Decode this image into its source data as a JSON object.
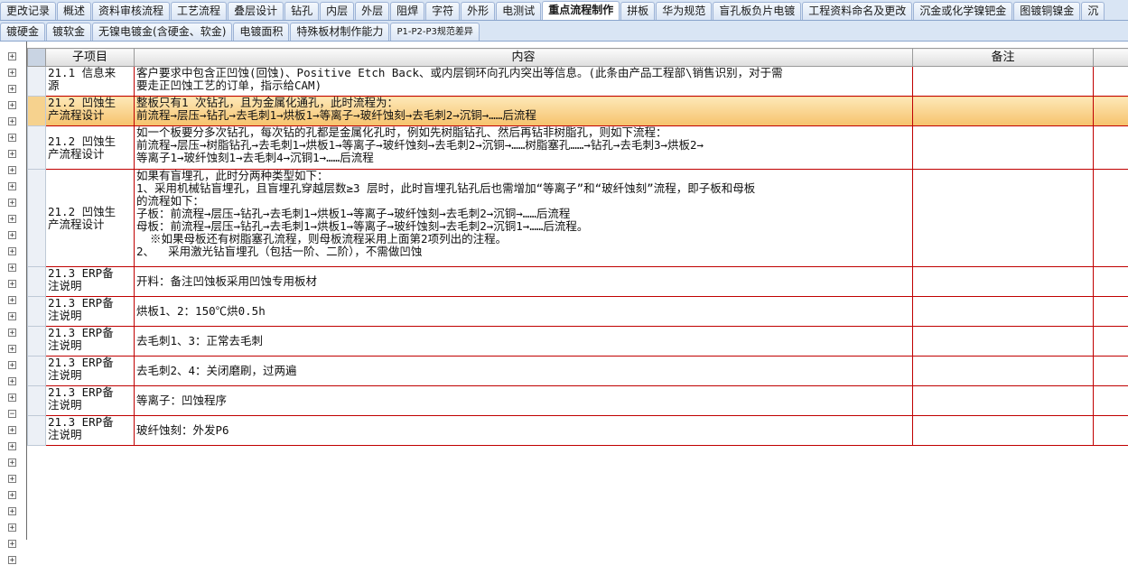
{
  "tabs_row1": [
    {
      "label": "更改记录",
      "active": false
    },
    {
      "label": "概述",
      "active": false
    },
    {
      "label": "资料审核流程",
      "active": false
    },
    {
      "label": "工艺流程",
      "active": false
    },
    {
      "label": "叠层设计",
      "active": false
    },
    {
      "label": "钻孔",
      "active": false
    },
    {
      "label": "内层",
      "active": false
    },
    {
      "label": "外层",
      "active": false
    },
    {
      "label": "阻焊",
      "active": false
    },
    {
      "label": "字符",
      "active": false
    },
    {
      "label": "外形",
      "active": false
    },
    {
      "label": "电测试",
      "active": false
    },
    {
      "label": "重点流程制作",
      "active": true
    },
    {
      "label": "拼板",
      "active": false
    },
    {
      "label": "华为规范",
      "active": false
    },
    {
      "label": "盲孔板负片电镀",
      "active": false
    },
    {
      "label": "工程资料命名及更改",
      "active": false
    },
    {
      "label": "沉金或化学镍钯金",
      "active": false
    },
    {
      "label": "图镀铜镍金",
      "active": false
    },
    {
      "label": "沉",
      "active": false
    }
  ],
  "tabs_row2": [
    {
      "label": "镀硬金",
      "active": false
    },
    {
      "label": "镀软金",
      "active": false
    },
    {
      "label": "无镍电镀金(含硬金、软金)",
      "active": false
    },
    {
      "label": "电镀面积",
      "active": false
    },
    {
      "label": "特殊板材制作能力",
      "active": false
    },
    {
      "label": "P1-P2-P3规范差异",
      "active": false
    }
  ],
  "grid": {
    "headers": {
      "sub": "子项目",
      "content": "内容",
      "remark": "备注"
    },
    "rows": [
      {
        "sub": [
          "21.1 信息来",
          "源"
        ],
        "content": [
          "客户要求中包含正凹蚀(回蚀)、Positive Etch Back、或内层铜环向孔内突出等信息。(此条由产品工程部\\销售识别，对于需",
          "要走正凹蚀工艺的订单，指示给CAM)"
        ],
        "remark": "",
        "selected": false
      },
      {
        "sub": [
          "21.2 凹蚀生",
          "产流程设计"
        ],
        "content": [
          "整板只有1 次钻孔，且为金属化通孔，此时流程为：",
          "前流程→层压→钻孔→去毛刺1→烘板1→等离子→玻纤蚀刻→去毛刺2→沉铜→……后流程"
        ],
        "remark": "",
        "selected": true
      },
      {
        "sub": [
          "21.2 凹蚀生",
          "产流程设计"
        ],
        "content": [
          "如一个板要分多次钻孔，每次钻的孔都是金属化孔时，例如先树脂钻孔、然后再钻非树脂孔，则如下流程：",
          "前流程→层压→树脂钻孔→去毛刺1→烘板1→等离子→玻纤蚀刻→去毛刺2→沉铜→……树脂塞孔……→钻孔→去毛刺3→烘板2→",
          "等离子1→玻纤蚀刻1→去毛刺4→沉铜1→……后流程"
        ],
        "remark": "",
        "selected": false
      },
      {
        "sub": [
          "21.2 凹蚀生",
          "产流程设计"
        ],
        "content": [
          "如果有盲埋孔，此时分两种类型如下：",
          "1、采用机械钻盲埋孔，且盲埋孔穿越层数≥3 层时，此时盲埋孔钻孔后也需增加“等离子”和“玻纤蚀刻”流程，即子板和母板",
          "的流程如下：",
          "子板：前流程→层压→钻孔→去毛刺1→烘板1→等离子→玻纤蚀刻→去毛刺2→沉铜→……后流程",
          "母板：前流程→层压→钻孔→去毛刺1→烘板1→等离子→玻纤蚀刻→去毛刺2→沉铜1→……后流程。",
          "  ※如果母板还有树脂塞孔流程，则母板流程采用上面第2项列出的注程。",
          "2、  采用激光钻盲埋孔（包括一阶、二阶），不需做凹蚀"
        ],
        "remark": "",
        "selected": false
      },
      {
        "sub": [
          "21.3 ERP备",
          "注说明"
        ],
        "content": [
          "开料：备注凹蚀板采用凹蚀专用板材"
        ],
        "remark": "",
        "selected": false
      },
      {
        "sub": [
          "21.3 ERP备",
          "注说明"
        ],
        "content": [
          "烘板1、2：150℃烘0.5h"
        ],
        "remark": "",
        "selected": false
      },
      {
        "sub": [
          "21.3 ERP备",
          "注说明"
        ],
        "content": [
          "去毛刺1、3：正常去毛刺"
        ],
        "remark": "",
        "selected": false
      },
      {
        "sub": [
          "21.3 ERP备",
          "注说明"
        ],
        "content": [
          "去毛刺2、4：关闭磨刷，过两遍"
        ],
        "remark": "",
        "selected": false
      },
      {
        "sub": [
          "21.3 ERP备",
          "注说明"
        ],
        "content": [
          "等离子：凹蚀程序"
        ],
        "remark": "",
        "selected": false
      },
      {
        "sub": [
          "21.3 ERP备",
          "注说明"
        ],
        "content": [
          "玻纤蚀刻：外发P6"
        ],
        "remark": "",
        "selected": false
      }
    ]
  },
  "tree_expanders": [
    {
      "symbol": "+"
    },
    {
      "symbol": "+"
    },
    {
      "symbol": "+"
    },
    {
      "symbol": "+"
    },
    {
      "symbol": "+"
    },
    {
      "symbol": "+"
    },
    {
      "symbol": "+"
    },
    {
      "symbol": "+"
    },
    {
      "symbol": "+"
    },
    {
      "symbol": "+"
    },
    {
      "symbol": "+"
    },
    {
      "symbol": "+"
    },
    {
      "symbol": "+"
    },
    {
      "symbol": "+"
    },
    {
      "symbol": "+"
    },
    {
      "symbol": "+"
    },
    {
      "symbol": "+"
    },
    {
      "symbol": "+"
    },
    {
      "symbol": "+"
    },
    {
      "symbol": "+"
    },
    {
      "symbol": "+"
    },
    {
      "symbol": "+"
    },
    {
      "symbol": "−"
    },
    {
      "symbol": "+"
    },
    {
      "symbol": "+"
    },
    {
      "symbol": "+"
    },
    {
      "symbol": "+"
    },
    {
      "symbol": "+"
    },
    {
      "symbol": "+"
    },
    {
      "symbol": "+"
    },
    {
      "symbol": "+"
    },
    {
      "symbol": "+"
    }
  ]
}
